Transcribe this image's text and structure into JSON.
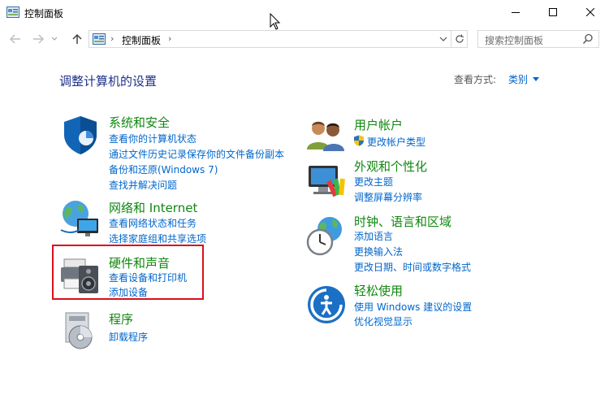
{
  "window": {
    "title": "控制面板"
  },
  "address": {
    "path": "控制面板",
    "search_placeholder": "搜索控制面板"
  },
  "header": {
    "title": "调整计算机的设置",
    "view_by_label": "查看方式:",
    "view_by_value": "类别"
  },
  "categories": [
    {
      "heading": "系统和安全",
      "icon": "shield-icon",
      "links": [
        "查看你的计算机状态",
        "通过文件历史记录保存你的文件备份副本",
        "备份和还原(Windows 7)",
        "查找并解决问题"
      ]
    },
    {
      "heading": "网络和 Internet",
      "icon": "network-globe-icon",
      "links": [
        "查看网络状态和任务",
        "选择家庭组和共享选项"
      ]
    },
    {
      "heading": "硬件和声音",
      "icon": "printer-speaker-icon",
      "links": [
        "查看设备和打印机",
        "添加设备"
      ]
    },
    {
      "heading": "程序",
      "icon": "programs-disc-icon",
      "links": [
        "卸载程序"
      ]
    },
    {
      "heading": "用户帐户",
      "icon": "users-icon",
      "links": [
        "更改帐户类型"
      ]
    },
    {
      "heading": "外观和个性化",
      "icon": "display-palette-icon",
      "links": [
        "更改主题",
        "调整屏幕分辨率"
      ]
    },
    {
      "heading": "时钟、语言和区域",
      "icon": "clock-globe-icon",
      "links": [
        "添加语言",
        "更换输入法",
        "更改日期、时间或数字格式"
      ]
    },
    {
      "heading": "轻松使用",
      "icon": "ease-of-access-icon",
      "links": [
        "使用 Windows 建议的设置",
        "优化视觉显示"
      ]
    }
  ],
  "colors": {
    "heading_green": "#10870f",
    "link_blue": "#0066cc",
    "title_blue": "#1e3287",
    "highlight_red": "#d9101a"
  }
}
